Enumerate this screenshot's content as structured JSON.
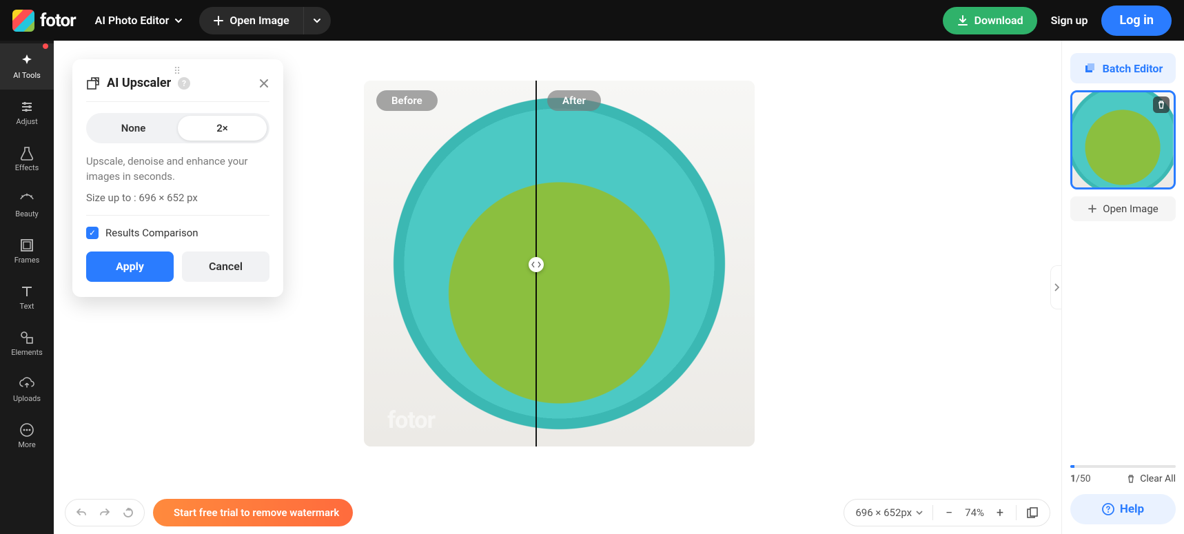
{
  "header": {
    "brand": "fotor",
    "editor_label": "AI Photo Editor",
    "open_image_label": "Open Image",
    "download_label": "Download",
    "signup_label": "Sign up",
    "login_label": "Log in"
  },
  "rail": {
    "items": [
      {
        "key": "ai-tools",
        "label": "AI Tools"
      },
      {
        "key": "adjust",
        "label": "Adjust"
      },
      {
        "key": "effects",
        "label": "Effects"
      },
      {
        "key": "beauty",
        "label": "Beauty"
      },
      {
        "key": "frames",
        "label": "Frames"
      },
      {
        "key": "text",
        "label": "Text"
      },
      {
        "key": "elements",
        "label": "Elements"
      },
      {
        "key": "uploads",
        "label": "Uploads"
      },
      {
        "key": "more",
        "label": "More"
      }
    ]
  },
  "ai_panel": {
    "title": "AI Upscaler",
    "seg_none": "None",
    "seg_2x": "2×",
    "description": "Upscale, denoise and enhance your images in seconds.",
    "size_line": "Size up to : 696 × 652 px",
    "results_comparison_label": "Results Comparison",
    "results_comparison_checked": true,
    "apply_label": "Apply",
    "cancel_label": "Cancel"
  },
  "compare": {
    "before_label": "Before",
    "after_label": "After",
    "watermark": "fotor"
  },
  "bottom_bar": {
    "trial_text": "Start free trial to remove watermark",
    "dimensions": "696 × 652px",
    "zoom_percent": "74%"
  },
  "right_sidebar": {
    "batch_editor_label": "Batch Editor",
    "open_image_label": "Open Image",
    "count_current": "1",
    "count_sep_total": "/50",
    "clear_all_label": "Clear All",
    "help_label": "Help"
  }
}
